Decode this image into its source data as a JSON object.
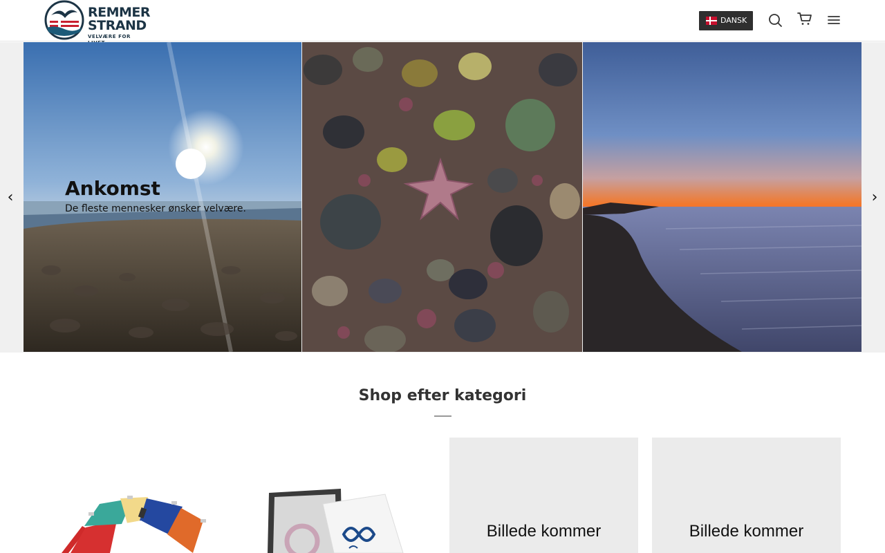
{
  "header": {
    "logo_line1": "REMMER",
    "logo_line2": "STRAND",
    "logo_tagline": "VELVÆRE FOR LIVET",
    "language_label": "DANSK",
    "icons": [
      "search-icon",
      "cart-icon",
      "menu-icon"
    ]
  },
  "hero": {
    "title": "Ankomst",
    "subtitle": "De fleste mennesker ønsker velvære.",
    "prev_arrow": "‹",
    "next_arrow": "›"
  },
  "categories": {
    "title": "Shop efter kategori",
    "placeholder_text": "Billede kommer"
  },
  "colors": {
    "header_button": "#2f2f2f",
    "brand_navy": "#1c3445",
    "brand_red": "#c8202f",
    "placeholder_bg": "#ebebeb"
  }
}
